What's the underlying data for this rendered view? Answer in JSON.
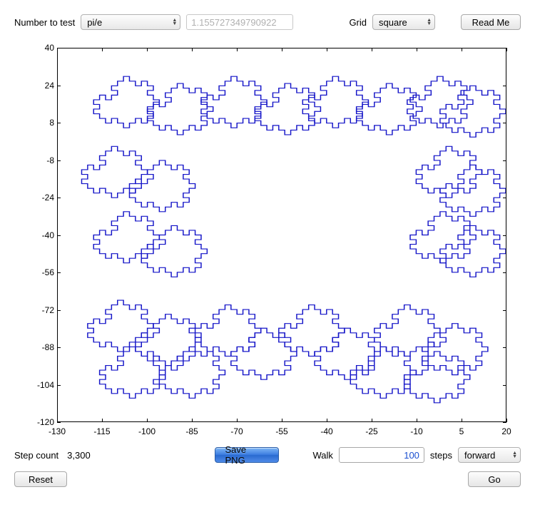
{
  "top": {
    "number_label": "Number to test",
    "number_select": "pi/e",
    "number_value": "1.155727349790922",
    "grid_label": "Grid",
    "grid_select": "square",
    "readme_label": "Read Me"
  },
  "chart_data": {
    "type": "line",
    "xlim": [
      -130,
      20
    ],
    "ylim": [
      -120,
      40
    ],
    "xticks": [
      -130,
      -115,
      -100,
      -85,
      -70,
      -55,
      -40,
      -25,
      -10,
      5,
      20
    ],
    "yticks": [
      -120,
      -104,
      -88,
      -72,
      -56,
      -40,
      -24,
      -8,
      8,
      24,
      40
    ],
    "note": "fractal-like random walk path"
  },
  "bottom": {
    "step_label": "Step count",
    "step_value": "3,300",
    "save_label": "Save PNG",
    "walk_label": "Walk",
    "walk_value": "100",
    "steps_label": "steps",
    "direction_select": "forward",
    "reset_label": "Reset",
    "go_label": "Go"
  }
}
